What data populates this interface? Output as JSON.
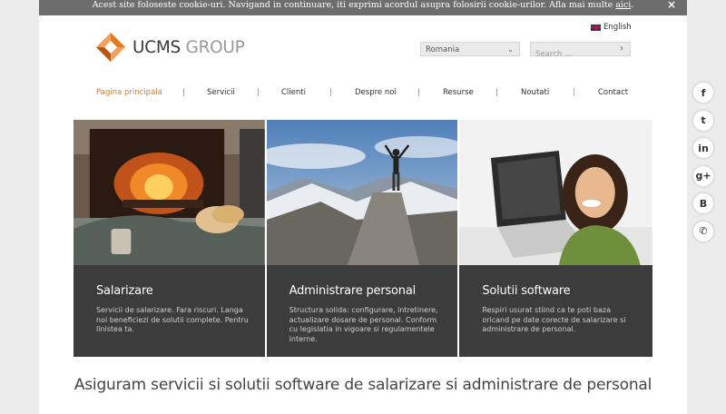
{
  "cookie_bar": {
    "text": "Acest site foloseste cookie-uri. Navigand in continuare, iti exprimi acordul asupra folosirii cookie-urilor. Afla mai multe ",
    "link": "aici",
    "period": ".",
    "close": "×"
  },
  "brand": {
    "logo_part1": "UCMS ",
    "logo_part2": "GROUP"
  },
  "language": {
    "label": "English"
  },
  "country_select": {
    "value": "Romania"
  },
  "search": {
    "placeholder": "Search ..."
  },
  "nav": {
    "items": [
      "Pagina principala",
      "Servicii",
      "Clienti",
      "Despre noi",
      "Resurse",
      "Noutati",
      "Contact"
    ],
    "separator": "|"
  },
  "tiles": [
    {
      "title": "Salarizare",
      "text": "Servicii de salarizare. Fara riscuri. Langa noi beneficiezi de solutii complete. Pentru linistea ta."
    },
    {
      "title": "Administrare personal",
      "text": "Structura solida: configurare, intretinere, actualizare dosare de personal. Conform cu legislatia in vigoare si regulamentele interne."
    },
    {
      "title": "Solutii software",
      "text": "Respiri usurat stiind ca te poti baza oricand pe date corecte de salarizare si administrare de personal."
    }
  ],
  "tagline": "Asiguram servicii si solutii software de salarizare si administrare de personal",
  "social": {
    "icons": [
      "facebook-icon",
      "twitter-icon",
      "linkedin-icon",
      "google-plus-icon",
      "blogger-icon",
      "phone-icon"
    ],
    "glyphs": [
      "f",
      "t",
      "in",
      "g+",
      "B",
      "✆"
    ]
  },
  "colors": {
    "accent": "#e07b1e",
    "caption_bg": "#3c3c3c",
    "cookie_bg": "#6d6d6d"
  }
}
